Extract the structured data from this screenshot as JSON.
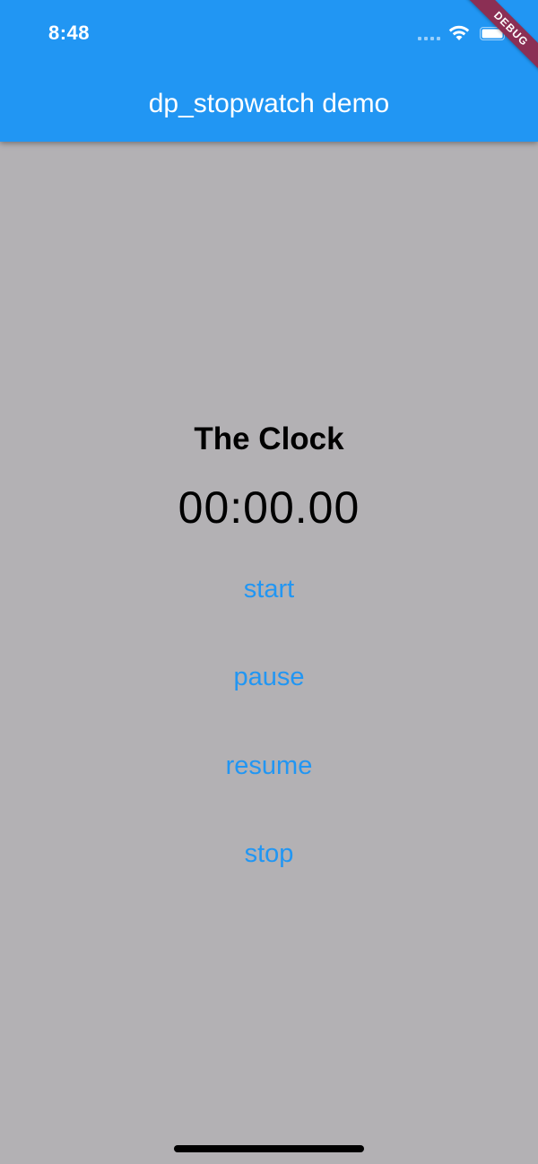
{
  "status_bar": {
    "time": "8:48"
  },
  "debug_banner": {
    "label": "DEBUG"
  },
  "app_bar": {
    "title": "dp_stopwatch demo"
  },
  "clock": {
    "title": "The Clock",
    "value": "00:00.00"
  },
  "buttons": {
    "start": "start",
    "pause": "pause",
    "resume": "resume",
    "stop": "stop"
  },
  "colors": {
    "app_bar": "#2196f3",
    "background": "#b3b1b4",
    "button_text": "#2196f3",
    "debug_ribbon": "#8b2f54"
  },
  "icons": {
    "signal": "cellular-signal-icon",
    "wifi": "wifi-icon",
    "battery": "battery-icon"
  }
}
